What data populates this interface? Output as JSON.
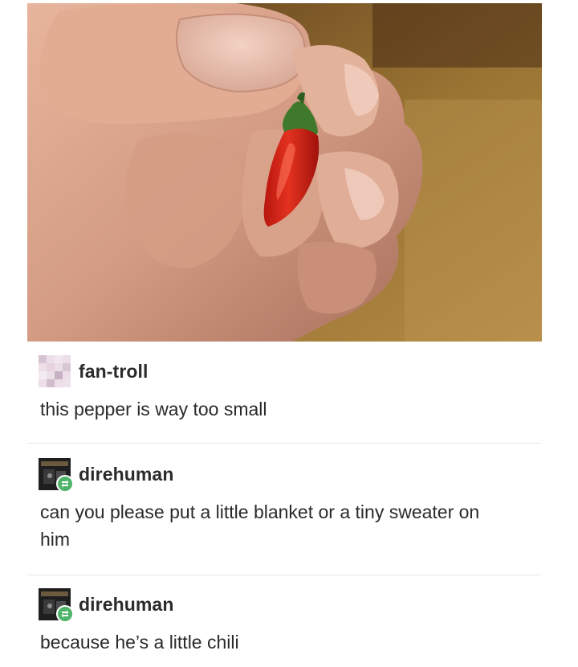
{
  "post": {
    "photo": {
      "subject": "small red chili pepper held between fingers"
    },
    "comments": [
      {
        "username": "fan-troll",
        "avatar": "pixelated-pink-avatar",
        "text": "this pepper is way too small"
      },
      {
        "username": "direhuman",
        "avatar": "dark-avatar-with-reblog-badge",
        "text": "can you please put a little blanket or a tiny sweater on him"
      },
      {
        "username": "direhuman",
        "avatar": "dark-avatar-with-reblog-badge",
        "text": "because he’s a little chili"
      }
    ]
  },
  "colors": {
    "background": "#ffffff",
    "divider": "#e6e6e6",
    "reblog_badge": "#4fb36a",
    "pepper": "#d8261a"
  }
}
